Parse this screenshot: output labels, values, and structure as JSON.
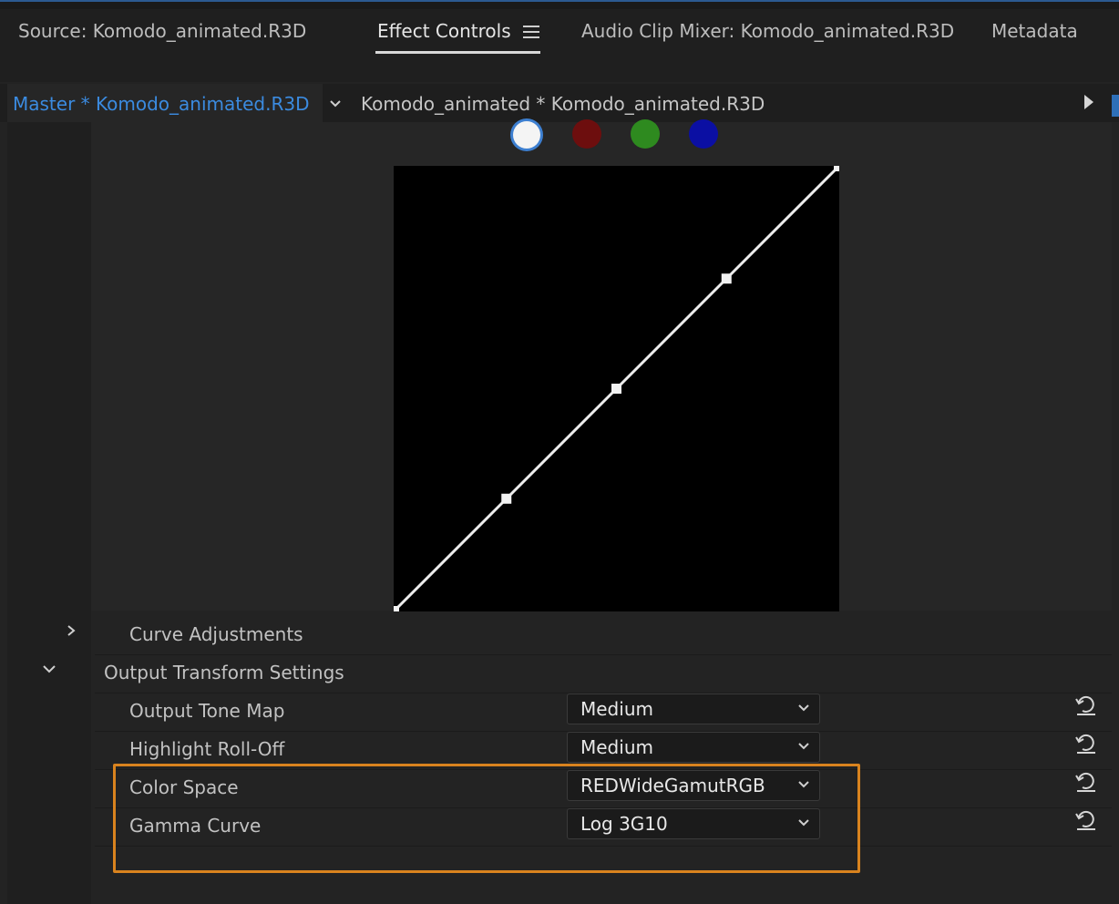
{
  "tabs": [
    {
      "label": "Source: Komodo_animated.R3D"
    },
    {
      "label": "Effect Controls"
    },
    {
      "label": "Audio Clip Mixer: Komodo_animated.R3D"
    },
    {
      "label": "Metadata"
    }
  ],
  "active_tab": "Effect Controls",
  "sequence_bar": {
    "master_clip": "Master * Komodo_animated.R3D",
    "clip": "Komodo_animated * Komodo_animated.R3D"
  },
  "curve_channels": [
    {
      "name": "channel-white",
      "color": "#f4f4f4"
    },
    {
      "name": "channel-red",
      "color": "#6d0e0e"
    },
    {
      "name": "channel-green",
      "color": "#2e8a1f"
    },
    {
      "name": "channel-blue",
      "color": "#0b0fa3"
    }
  ],
  "curve_points": [
    [
      0,
      0
    ],
    [
      0.25,
      0.25
    ],
    [
      0.5,
      0.5
    ],
    [
      0.75,
      0.75
    ],
    [
      1,
      1
    ]
  ],
  "sections": {
    "curve_adjustments": "Curve Adjustments",
    "output_transform": "Output Transform Settings"
  },
  "settings": [
    {
      "label": "Output Tone Map",
      "value": "Medium"
    },
    {
      "label": "Highlight Roll-Off",
      "value": "Medium"
    },
    {
      "label": "Color Space",
      "value": "REDWideGamutRGB"
    },
    {
      "label": "Gamma Curve",
      "value": "Log 3G10"
    }
  ],
  "highlight_color": "#d9831e",
  "accent_color": "#3b8be0"
}
